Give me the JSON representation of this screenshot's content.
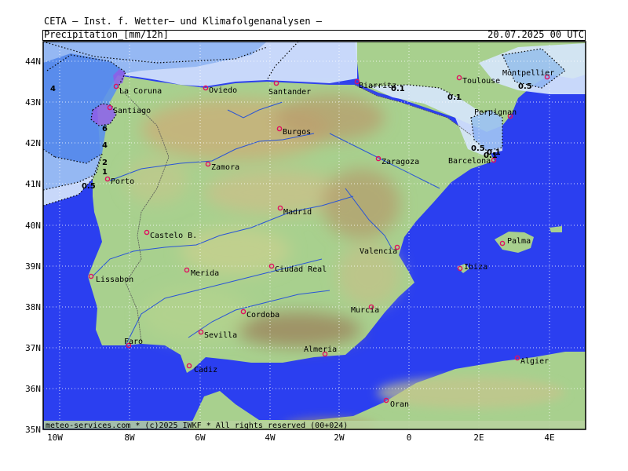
{
  "header": {
    "title": "CETA — Inst. f. Wetter— und Klimafolgenanalysen —",
    "parameter": "Precipitation",
    "unit": "mm/12h",
    "datetime": "20.07.2025 00 UTC"
  },
  "footer": {
    "credit": "meteo-services.com * (c)2025 IWKF * All rights reserved (00+024)"
  },
  "axes": {
    "lat_labels": [
      "44N",
      "43N",
      "42N",
      "41N",
      "40N",
      "39N",
      "38N",
      "37N",
      "36N",
      "35N"
    ],
    "lon_labels": [
      "10W",
      "8W",
      "6W",
      "4W",
      "2W",
      "0",
      "2E",
      "4E"
    ]
  },
  "cities": [
    {
      "name": "La Coruna"
    },
    {
      "name": "Santiago"
    },
    {
      "name": "Oviedo"
    },
    {
      "name": "Santander"
    },
    {
      "name": "Biarritz"
    },
    {
      "name": "Toulouse"
    },
    {
      "name": "Montpellier"
    },
    {
      "name": "Perpignan"
    },
    {
      "name": "Burgos"
    },
    {
      "name": "Zaragoza"
    },
    {
      "name": "Barcelona"
    },
    {
      "name": "Porto"
    },
    {
      "name": "Zamora"
    },
    {
      "name": "Madrid"
    },
    {
      "name": "Castelo B."
    },
    {
      "name": "Valencia"
    },
    {
      "name": "Palma"
    },
    {
      "name": "Ibiza"
    },
    {
      "name": "Lissabon"
    },
    {
      "name": "Merida"
    },
    {
      "name": "Ciudad Real"
    },
    {
      "name": "Murcia"
    },
    {
      "name": "Cordoba"
    },
    {
      "name": "Sevilla"
    },
    {
      "name": "Faro"
    },
    {
      "name": "Almeria"
    },
    {
      "name": "Cadiz"
    },
    {
      "name": "Algier"
    },
    {
      "name": "Oran"
    }
  ],
  "contour_labels": [
    "4",
    "6",
    "4",
    "2",
    "1",
    "0.5",
    "0.1",
    "0.1",
    "0.1",
    "0.5",
    "0.5",
    "0.1"
  ],
  "colors": {
    "sea": "#2b3ff0",
    "precip_light": "#d6e6fb",
    "precip_mid": "#9ec3f4",
    "precip_high": "#5d93ec",
    "precip_max": "#8f68e8",
    "land_low": "#9fd08a",
    "land_mid": "#c8d48f",
    "land_high": "#a88d62",
    "city_marker": "#e01060",
    "river": "#2a55d6"
  }
}
